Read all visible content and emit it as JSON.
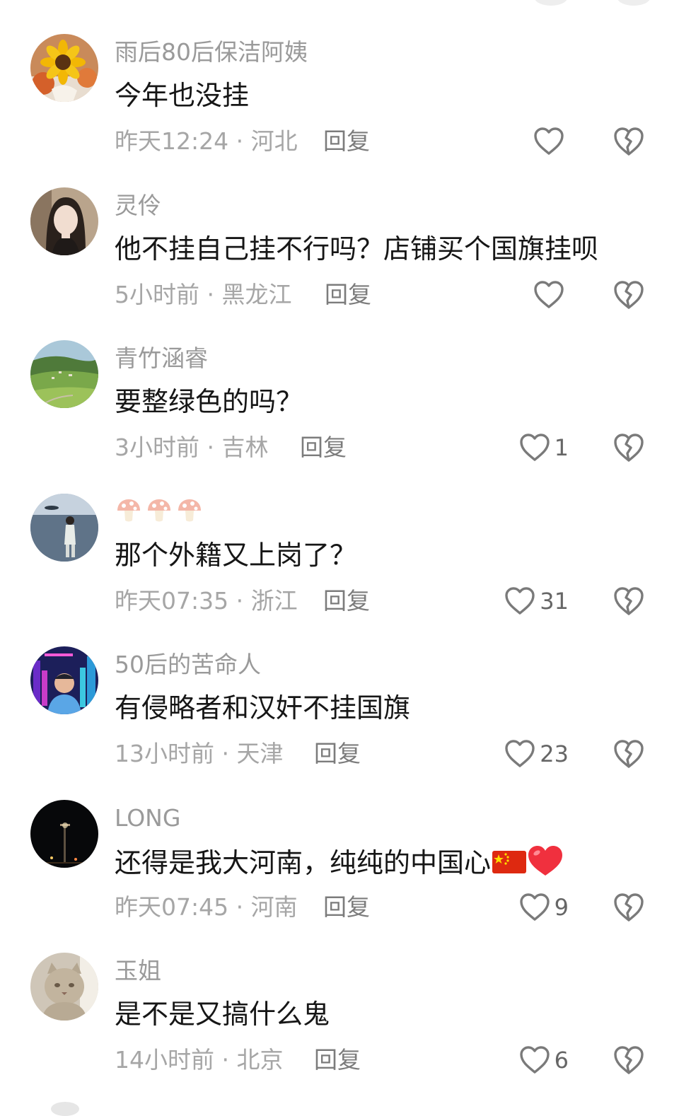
{
  "comments": [
    {
      "username": "雨后80后保洁阿姨",
      "text": "今年也没挂",
      "meta": "昨天12:24 · 河北",
      "reply_label": "回复",
      "likes": "",
      "avatar_icon": "sunflower-avatar-icon"
    },
    {
      "username": "灵伶",
      "text": "他不挂自己挂不行吗？店铺买个国旗挂呗",
      "meta": "5小时前 · 黑龙江",
      "reply_label": "回复",
      "likes": "",
      "avatar_icon": "woman-portrait-avatar-icon"
    },
    {
      "username": "青竹涵睿",
      "text": "要整绿色的吗？",
      "meta": "3小时前 · 吉林",
      "reply_label": "回复",
      "likes": "1",
      "avatar_icon": "green-landscape-avatar-icon"
    },
    {
      "username": "",
      "username_icons": [
        "mushroom-icon",
        "mushroom-icon",
        "mushroom-icon"
      ],
      "text": "那个外籍又上岗了？",
      "meta": "昨天07:35 · 浙江",
      "reply_label": "回复",
      "likes": "31",
      "avatar_icon": "lakeside-person-avatar-icon"
    },
    {
      "username": "50后的苦命人",
      "text": "有侵略者和汉奸不挂国旗",
      "meta": "13小时前 · 天津",
      "reply_label": "回复",
      "likes": "23",
      "avatar_icon": "neon-city-man-avatar-icon"
    },
    {
      "username": "LONG",
      "text": "还得是我大河南，纯纯的中国心",
      "text_emoji": [
        "china-flag-icon",
        "red-heart-icon"
      ],
      "meta": "昨天07:45 · 河南",
      "reply_label": "回复",
      "likes": "9",
      "avatar_icon": "night-streetlight-avatar-icon"
    },
    {
      "username": "玉姐",
      "text": "是不是又搞什么鬼",
      "meta": "14小时前 · 北京",
      "reply_label": "回复",
      "likes": "6",
      "avatar_icon": "cat-avatar-icon"
    }
  ],
  "colors": {
    "username": "#9a9a9a",
    "text": "#161616",
    "meta": "#a6a6a6",
    "reply": "#7c7c7c",
    "icon_stroke": "#7a7a7a",
    "flag_red": "#de2910",
    "flag_star": "#ffde00",
    "heart_red": "#f0303e"
  }
}
